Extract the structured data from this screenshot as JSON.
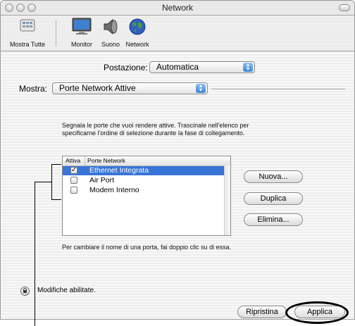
{
  "window": {
    "title": "Network"
  },
  "toolbar": {
    "items": [
      {
        "label": "Mostra Tutte",
        "icon": "show-all-icon"
      },
      {
        "label": "Monitor",
        "icon": "monitor-icon"
      },
      {
        "label": "Suono",
        "icon": "speaker-icon"
      },
      {
        "label": "Network",
        "icon": "globe-icon"
      }
    ]
  },
  "location": {
    "label": "Postazione:",
    "value": "Automatica"
  },
  "show": {
    "label": "Mostra:",
    "value": "Porte Network Attive"
  },
  "instructions": {
    "line1": "Segnala le porte che vuoi rendere attive. Trascinale nell'elenco per",
    "line2": "specificarne l'ordine di selezione durante la fase di collegamento."
  },
  "ports_list": {
    "header_active": "Attiva",
    "header_ports": "Porte Network",
    "rows": [
      {
        "name": "Ethernet Integrata",
        "active": true,
        "selected": true
      },
      {
        "name": "Air Port",
        "active": false,
        "selected": false
      },
      {
        "name": "Modem Interno",
        "active": false,
        "selected": false
      }
    ]
  },
  "buttons": {
    "new": "Nuova...",
    "duplicate": "Duplica",
    "delete": "Elimina...",
    "revert": "Ripristina",
    "apply": "Applica"
  },
  "rename_hint": "Per cambiare il nome di una porta, fai doppio clic su di essa.",
  "lock_status": "Modifiche abilitate.",
  "colors": {
    "selection": "#3875d7",
    "accent_blue": "#3d86d8"
  }
}
